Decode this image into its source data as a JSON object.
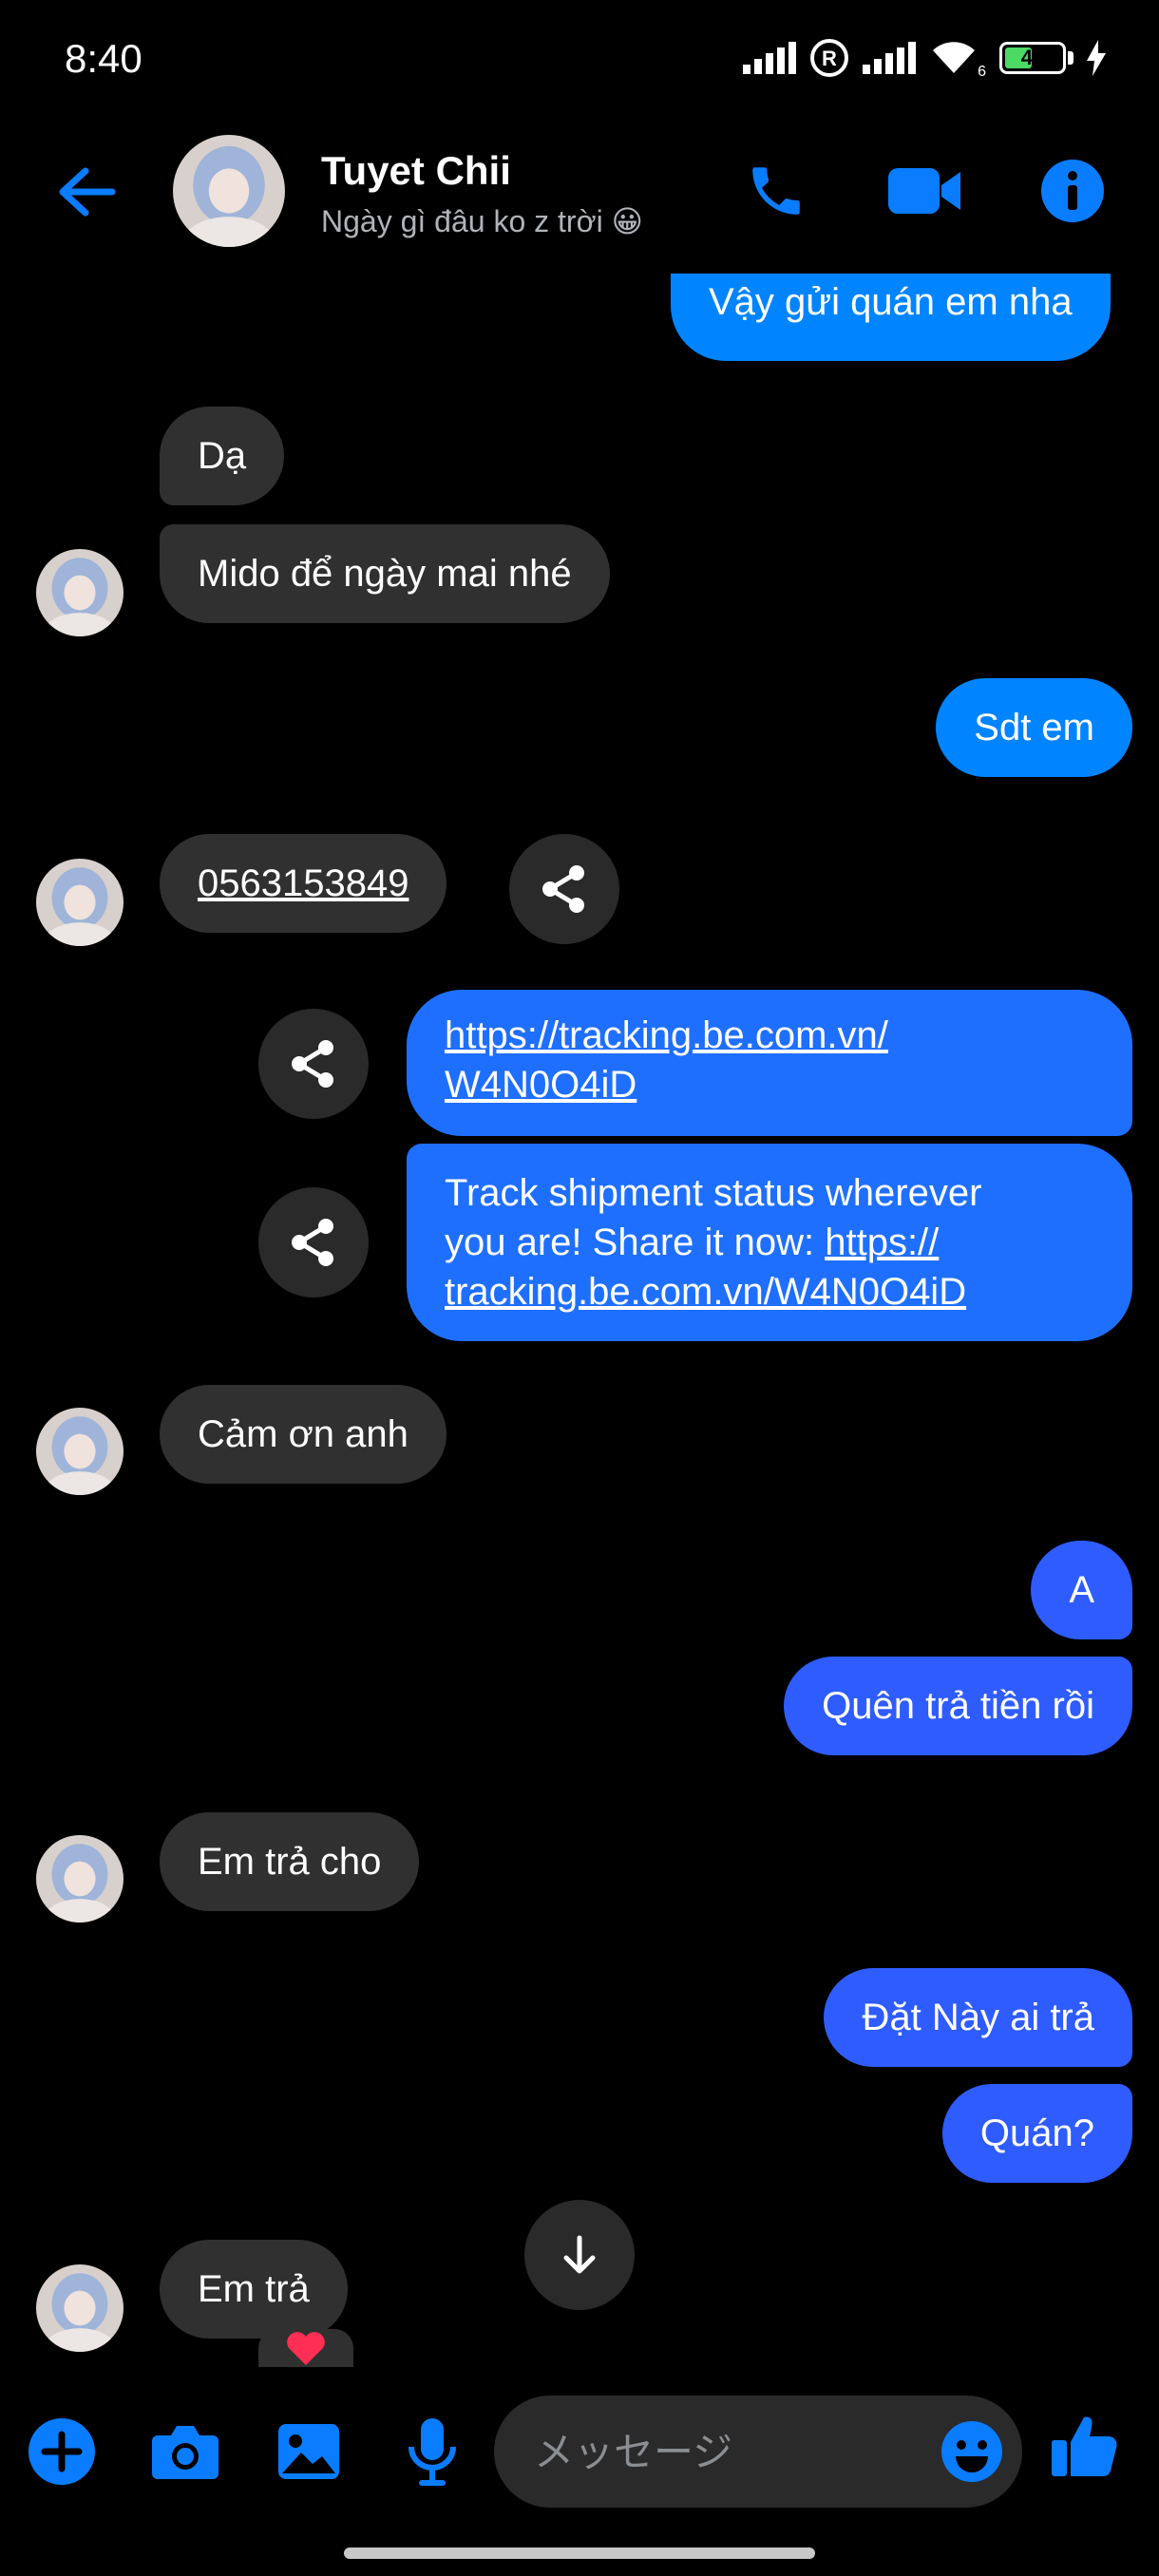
{
  "status_bar": {
    "time": "8:40",
    "battery_level": "46",
    "wifi_label": "6"
  },
  "header": {
    "name": "Tuyet Chii",
    "status": "Ngày gì đâu ko z trời 😀"
  },
  "messages": [
    {
      "side": "out",
      "text": "Vậy gửi quán em nha"
    },
    {
      "side": "in",
      "text": "Dạ"
    },
    {
      "side": "in",
      "text": "Mido để ngày mai nhé"
    },
    {
      "side": "out",
      "text": "Sdt em"
    },
    {
      "side": "in",
      "text": "0563153849"
    },
    {
      "side": "out",
      "text_l1": "https://tracking.be.com.vn/",
      "text_l2": "W4N0O4iD"
    },
    {
      "side": "out",
      "text_l1": "Track shipment status wherever",
      "text_l2a": "you are! Share it now: ",
      "text_l2b": "https://",
      "text_l3": "tracking.be.com.vn/W4N0O4iD"
    },
    {
      "side": "in",
      "text": "Cảm ơn anh"
    },
    {
      "side": "out",
      "text": "A"
    },
    {
      "side": "out",
      "text": "Quên trả tiền rồi"
    },
    {
      "side": "in",
      "text": "Em trả cho"
    },
    {
      "side": "out",
      "text": "Đặt Này ai trả"
    },
    {
      "side": "out",
      "text": "Quán?"
    },
    {
      "side": "in",
      "text": "Em trả"
    }
  ],
  "composer": {
    "placeholder": "メッセージ"
  },
  "colors": {
    "accent": "#0084ff",
    "incoming_bubble": "#303030",
    "background": "#000000"
  },
  "icons": [
    "back-arrow-icon",
    "phone-icon",
    "video-camera-icon",
    "info-icon",
    "share-icon",
    "arrow-down-icon",
    "plus-icon",
    "camera-icon",
    "image-icon",
    "microphone-icon",
    "emoji-icon",
    "thumbs-up-icon"
  ]
}
